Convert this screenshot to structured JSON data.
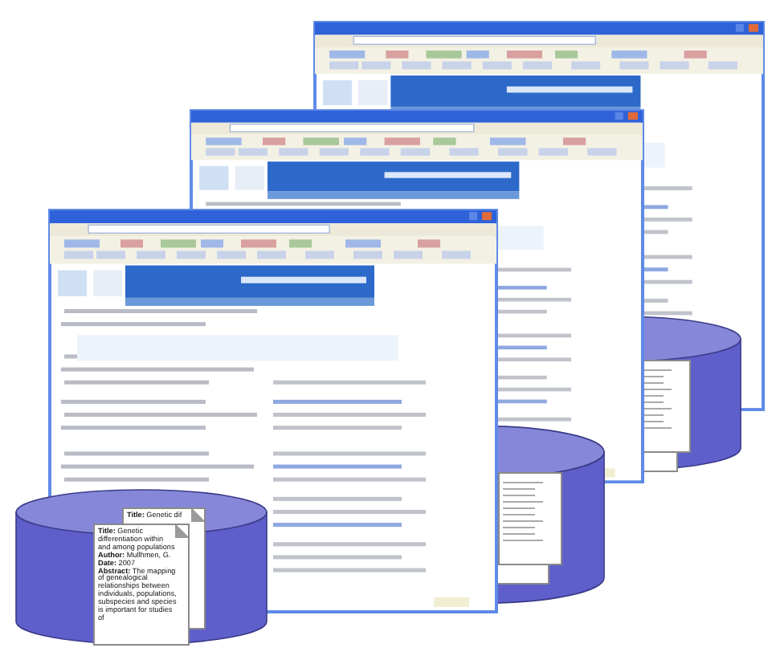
{
  "stack": {
    "windows": [
      {
        "kind": "browser"
      },
      {
        "kind": "browser"
      },
      {
        "kind": "browser"
      }
    ]
  },
  "front_record": {
    "back_title": "**Title:** Genetic dif",
    "fields": [
      "**Title:** Genetic differentiation within and among populations",
      "**Author:** Mullhmen, G.",
      "**Date:** 2007",
      "**Abstract:** The mapping of genealogical relationships between individuals, populations, subspecies and species is important for studies of"
    ]
  }
}
